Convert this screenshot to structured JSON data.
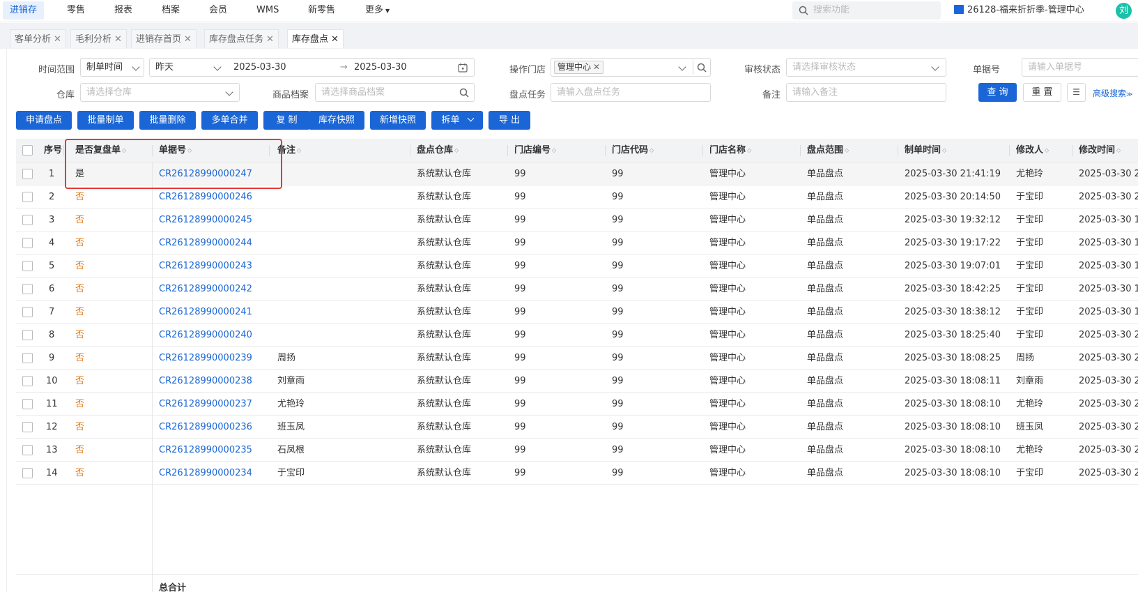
{
  "nav": {
    "items": [
      "进销存",
      "零售",
      "报表",
      "档案",
      "会员",
      "WMS",
      "新零售",
      "更多"
    ],
    "search_placeholder": "搜索功能",
    "store": "26128-福来折折季-管理中心",
    "avatar": "刘"
  },
  "tabs": [
    "客单分析",
    "毛利分析",
    "进销存首页",
    "库存盘点任务",
    "库存盘点"
  ],
  "filters": {
    "time_range_label": "时间范围",
    "time_type": "制单时间",
    "time_preset": "昨天",
    "date_start": "2025-03-30",
    "date_end": "2025-03-30",
    "store_label": "操作门店",
    "store_tag": "管理中心",
    "audit_label": "审核状态",
    "audit_placeholder": "请选择审核状态",
    "doc_no_label": "单据号",
    "doc_no_placeholder": "请输入单据号",
    "warehouse_label": "仓库",
    "warehouse_placeholder": "请选择仓库",
    "goods_label": "商品档案",
    "goods_placeholder": "请选择商品档案",
    "task_label": "盘点任务",
    "task_placeholder": "请输入盘点任务",
    "remark_label": "备注",
    "remark_placeholder": "请输入备注",
    "query_btn": "查 询",
    "reset_btn": "重 置",
    "advanced": "高级搜索"
  },
  "actions": [
    "申请盘点",
    "批量制单",
    "批量删除",
    "多单合并",
    "复 制",
    "库存快照",
    "新增快照",
    "拆单",
    "导 出"
  ],
  "table": {
    "headers": [
      "序号",
      "是否复盘单",
      "单据号",
      "备注",
      "盘点仓库",
      "门店编号",
      "门店代码",
      "门店名称",
      "盘点范围",
      "制单时间",
      "修改人",
      "修改时间"
    ],
    "rows": [
      {
        "idx": "1",
        "recheck": "是",
        "doc": "CR26128990000247",
        "remark": "",
        "wh": "系统默认仓库",
        "sno": "99",
        "scode": "99",
        "sname": "管理中心",
        "range": "单品盘点",
        "ctime": "2025-03-30 21:41:19",
        "modifier": "尤艳玲",
        "mtime": "2025-03-30 2"
      },
      {
        "idx": "2",
        "recheck": "否",
        "doc": "CR26128990000246",
        "remark": "",
        "wh": "系统默认仓库",
        "sno": "99",
        "scode": "99",
        "sname": "管理中心",
        "range": "单品盘点",
        "ctime": "2025-03-30 20:14:50",
        "modifier": "于宝印",
        "mtime": "2025-03-30 2"
      },
      {
        "idx": "3",
        "recheck": "否",
        "doc": "CR26128990000245",
        "remark": "",
        "wh": "系统默认仓库",
        "sno": "99",
        "scode": "99",
        "sname": "管理中心",
        "range": "单品盘点",
        "ctime": "2025-03-30 19:32:12",
        "modifier": "于宝印",
        "mtime": "2025-03-30 1"
      },
      {
        "idx": "4",
        "recheck": "否",
        "doc": "CR26128990000244",
        "remark": "",
        "wh": "系统默认仓库",
        "sno": "99",
        "scode": "99",
        "sname": "管理中心",
        "range": "单品盘点",
        "ctime": "2025-03-30 19:17:22",
        "modifier": "于宝印",
        "mtime": "2025-03-30 1"
      },
      {
        "idx": "5",
        "recheck": "否",
        "doc": "CR26128990000243",
        "remark": "",
        "wh": "系统默认仓库",
        "sno": "99",
        "scode": "99",
        "sname": "管理中心",
        "range": "单品盘点",
        "ctime": "2025-03-30 19:07:01",
        "modifier": "于宝印",
        "mtime": "2025-03-30 1"
      },
      {
        "idx": "6",
        "recheck": "否",
        "doc": "CR26128990000242",
        "remark": "",
        "wh": "系统默认仓库",
        "sno": "99",
        "scode": "99",
        "sname": "管理中心",
        "range": "单品盘点",
        "ctime": "2025-03-30 18:42:25",
        "modifier": "于宝印",
        "mtime": "2025-03-30 1"
      },
      {
        "idx": "7",
        "recheck": "否",
        "doc": "CR26128990000241",
        "remark": "",
        "wh": "系统默认仓库",
        "sno": "99",
        "scode": "99",
        "sname": "管理中心",
        "range": "单品盘点",
        "ctime": "2025-03-30 18:38:12",
        "modifier": "于宝印",
        "mtime": "2025-03-30 1"
      },
      {
        "idx": "8",
        "recheck": "否",
        "doc": "CR26128990000240",
        "remark": "",
        "wh": "系统默认仓库",
        "sno": "99",
        "scode": "99",
        "sname": "管理中心",
        "range": "单品盘点",
        "ctime": "2025-03-30 18:25:40",
        "modifier": "于宝印",
        "mtime": "2025-03-30 2"
      },
      {
        "idx": "9",
        "recheck": "否",
        "doc": "CR26128990000239",
        "remark": "周扬",
        "wh": "系统默认仓库",
        "sno": "99",
        "scode": "99",
        "sname": "管理中心",
        "range": "单品盘点",
        "ctime": "2025-03-30 18:08:25",
        "modifier": "周扬",
        "mtime": "2025-03-30 2"
      },
      {
        "idx": "10",
        "recheck": "否",
        "doc": "CR26128990000238",
        "remark": "刘章雨",
        "wh": "系统默认仓库",
        "sno": "99",
        "scode": "99",
        "sname": "管理中心",
        "range": "单品盘点",
        "ctime": "2025-03-30 18:08:11",
        "modifier": "刘章雨",
        "mtime": "2025-03-30 2"
      },
      {
        "idx": "11",
        "recheck": "否",
        "doc": "CR26128990000237",
        "remark": "尤艳玲",
        "wh": "系统默认仓库",
        "sno": "99",
        "scode": "99",
        "sname": "管理中心",
        "range": "单品盘点",
        "ctime": "2025-03-30 18:08:10",
        "modifier": "尤艳玲",
        "mtime": "2025-03-30 2"
      },
      {
        "idx": "12",
        "recheck": "否",
        "doc": "CR26128990000236",
        "remark": "班玉凤",
        "wh": "系统默认仓库",
        "sno": "99",
        "scode": "99",
        "sname": "管理中心",
        "range": "单品盘点",
        "ctime": "2025-03-30 18:08:10",
        "modifier": "班玉凤",
        "mtime": "2025-03-30 2"
      },
      {
        "idx": "13",
        "recheck": "否",
        "doc": "CR26128990000235",
        "remark": "石凤根",
        "wh": "系统默认仓库",
        "sno": "99",
        "scode": "99",
        "sname": "管理中心",
        "range": "单品盘点",
        "ctime": "2025-03-30 18:08:10",
        "modifier": "尤艳玲",
        "mtime": "2025-03-30 2"
      },
      {
        "idx": "14",
        "recheck": "否",
        "doc": "CR26128990000234",
        "remark": "于宝印",
        "wh": "系统默认仓库",
        "sno": "99",
        "scode": "99",
        "sname": "管理中心",
        "range": "单品盘点",
        "ctime": "2025-03-30 18:08:10",
        "modifier": "于宝印",
        "mtime": "2025-03-30 2"
      }
    ],
    "total_label": "总合计"
  },
  "colors": {
    "primary": "#1a66d6",
    "no_value": "#e07b1a",
    "annotation": "#e53935"
  }
}
